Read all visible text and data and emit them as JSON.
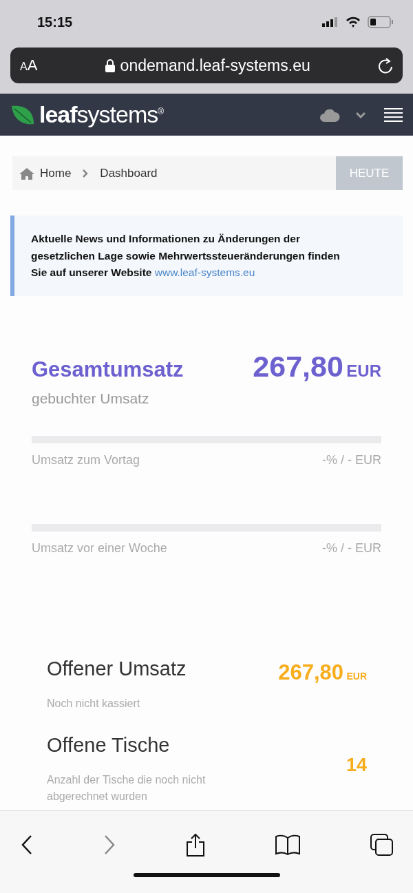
{
  "status_bar": {
    "time": "15:15"
  },
  "browser": {
    "text_size_button": "AA",
    "url": "ondemand.leaf-systems.eu"
  },
  "header": {
    "logo": "**leaf**systems$^{®}$"
  },
  "breadcrumb": {
    "items": [
      "Home",
      "Dashboard"
    ],
    "button": "HEUTE"
  },
  "notice": {
    "text": "Aktuelle News und Informationen zu Änderungen der gesetzlichen Lage sowie Mehrwertssteueränderungen finden Sie auf unserer Website",
    "link": "www.leaf-systems.eu"
  },
  "total": {
    "title": "Gesamtumsatz",
    "amount": "267,80",
    "currency": "EUR",
    "subtitle": "gebuchter Umsatz"
  },
  "comparisons": [
    {
      "label": "Umsatz zum Vortag",
      "value": "-% / - EUR"
    },
    {
      "label": "Umsatz vor einer Woche",
      "value": "-% / - EUR"
    }
  ],
  "stats": [
    {
      "title": "Offener Umsatz",
      "description": "Noch nicht kassiert",
      "amount": "267,80",
      "currency": "EUR"
    },
    {
      "title": "Offene Tische",
      "description": "Anzahl der Tische die noch nicht abgerechnet wurden",
      "amount": "14"
    }
  ]
}
